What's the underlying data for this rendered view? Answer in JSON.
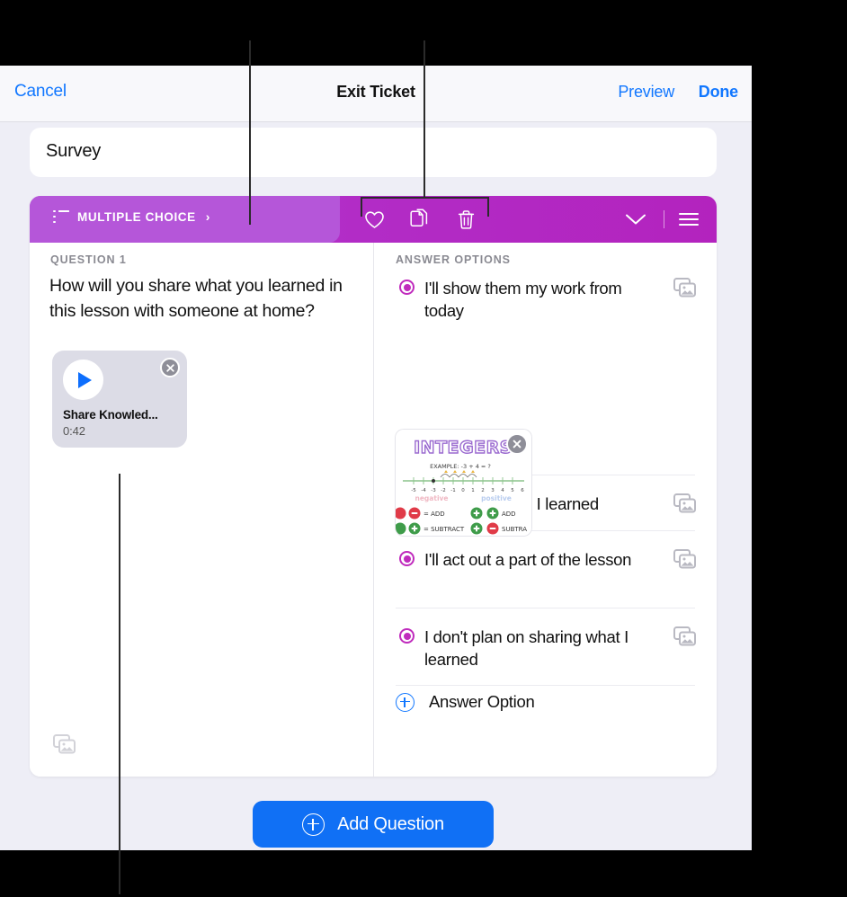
{
  "navbar": {
    "cancel_label": "Cancel",
    "title": "Exit Ticket",
    "preview_label": "Preview",
    "done_label": "Done"
  },
  "survey_field": {
    "value": "Survey",
    "placeholder": "Survey"
  },
  "question_card": {
    "toolbar": {
      "type_label": "MULTIPLE CHOICE",
      "type_chevron": "›",
      "icons": [
        {
          "name": "favorite-icon",
          "label": "Favorite"
        },
        {
          "name": "duplicate-icon",
          "label": "Duplicate"
        },
        {
          "name": "trash-icon",
          "label": "Delete"
        }
      ],
      "collapse_icon": "chevron-down-icon",
      "reorder_icon": "hamburger-icon"
    },
    "left_pane": {
      "section_label": "QUESTION 1",
      "question_text": "How will you share what you learned in this lesson with someone at home?",
      "audio_attachment": {
        "title": "Share Knowled...",
        "duration": "0:42",
        "play_icon": "play-icon",
        "remove_icon": "close-icon"
      },
      "add_media_icon": "photos-icon"
    },
    "right_pane": {
      "section_label": "ANSWER OPTIONS",
      "options": [
        {
          "text": "I'll show them my work from today",
          "selected": true,
          "media_icon": "photos-icon"
        },
        {
          "text": "I'll explain what I learned",
          "selected": true,
          "media_icon": "photos-icon"
        },
        {
          "text": "I'll act out a part of the lesson",
          "selected": true,
          "media_icon": "photos-icon"
        },
        {
          "text": "I don't plan on sharing what I learned",
          "selected": true,
          "media_icon": "photos-icon"
        }
      ],
      "attachment_thumbnail": {
        "alt": "INTEGERS handwritten poster with number line",
        "title": "INTEGERS",
        "example": "EXAMPLE: -3 + 4 = ?",
        "axis_ticks": [
          "-5",
          "-4",
          "-3",
          "-2",
          "-1",
          "0",
          "1",
          "2",
          "3",
          "4",
          "5",
          "6"
        ],
        "left_label": "negative",
        "right_label": "positive",
        "rules": [
          {
            "signs": "- -",
            "result": "ADD"
          },
          {
            "signs": "+ +",
            "result": "ADD"
          },
          {
            "signs": "- +",
            "result": "SUBTRACT"
          },
          {
            "signs": "+ -",
            "result": "SUBTRACT"
          }
        ],
        "remove_icon": "close-icon"
      },
      "add_option_label": "Answer Option",
      "add_option_icon": "circle-plus-icon"
    }
  },
  "footer": {
    "add_question_label": "Add Question",
    "add_question_icon": "circle-plus-icon"
  },
  "colors": {
    "accent_blue": "#1177ff",
    "toolbar_purple_light": "#b556d9",
    "toolbar_purple_dark": "#b323be",
    "radio_magenta": "#c02bbd",
    "screen_bg": "#eeeef6"
  }
}
